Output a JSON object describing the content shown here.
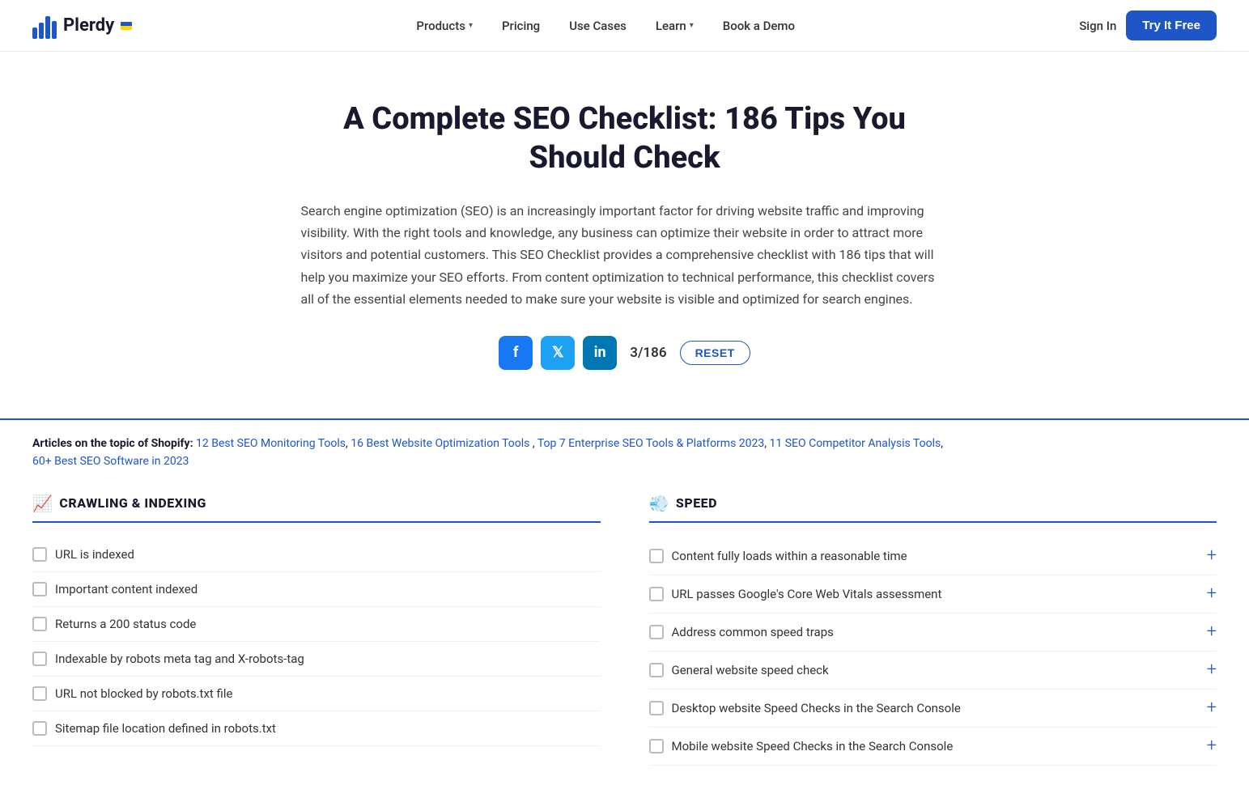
{
  "nav": {
    "logo_text": "Plerdy",
    "items": [
      {
        "label": "Products",
        "has_chevron": true
      },
      {
        "label": "Pricing",
        "has_chevron": false
      },
      {
        "label": "Use Cases",
        "has_chevron": false
      },
      {
        "label": "Learn",
        "has_chevron": true
      },
      {
        "label": "Book a Demo",
        "has_chevron": false
      }
    ],
    "sign_in": "Sign In",
    "try_free": "Try It Free"
  },
  "hero": {
    "title": "A Complete SEO Checklist: 186 Tips You Should Check",
    "description": "Search engine optimization (SEO) is an increasingly important factor for driving website traffic and improving visibility. With the right tools and knowledge, any business can optimize their website in order to attract more visitors and potential customers. This SEO Checklist provides a comprehensive checklist with 186 tips that will help you maximize your SEO efforts. From content optimization to technical performance, this checklist covers all of the essential elements needed to make sure your website is visible and optimized for search engines.",
    "counter": "3/186",
    "reset_label": "RESET"
  },
  "articles": {
    "prefix": "Articles on the topic of Shopify:",
    "links": [
      "12 Best SEO Monitoring Tools",
      "16 Best Website Optimization Tools",
      "Top 7 Enterprise SEO Tools & Platforms 2023",
      "11 SEO Competitor Analysis Tools",
      "60+ Best SEO Software in 2023"
    ]
  },
  "sections": [
    {
      "id": "crawling",
      "icon": "📈",
      "title": "CRAWLING & INDEXING",
      "items": [
        "URL is indexed",
        "Important content indexed",
        "Returns a 200 status code",
        "Indexable by robots meta tag and X-robots-tag",
        "URL not blocked by robots.txt file",
        "Sitemap file location defined in robots.txt"
      ]
    },
    {
      "id": "speed",
      "icon": "💨",
      "title": "SPEED",
      "items": [
        "Content fully loads within a reasonable time",
        "URL passes Google's Core Web Vitals assessment",
        "Address common speed traps",
        "General website speed check",
        "Desktop website Speed Checks in the Search Console",
        "Mobile website Speed Checks in the Search Console"
      ]
    }
  ]
}
